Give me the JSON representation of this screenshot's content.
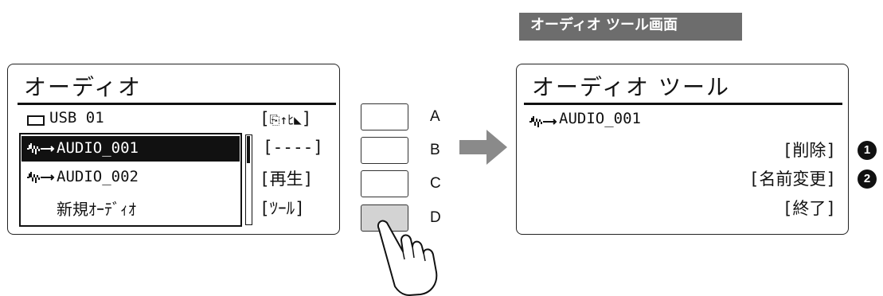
{
  "header": {
    "title": "オーディオ ツール画面"
  },
  "left_panel": {
    "title": "オーディオ",
    "device": "USB 01",
    "files": [
      {
        "name": "AUDIO_001",
        "selected": true
      },
      {
        "name": "AUDIO_002",
        "selected": false
      },
      {
        "name": "新規ｵｰﾃﾞｨｵ",
        "selected": false
      }
    ],
    "soft_keys": [
      "[",
      "----]",
      "[再生]",
      "[ﾂｰﾙ]"
    ]
  },
  "side_buttons": [
    {
      "label": "A",
      "pressed": false
    },
    {
      "label": "B",
      "pressed": false
    },
    {
      "label": "C",
      "pressed": false
    },
    {
      "label": "D",
      "pressed": true
    }
  ],
  "right_panel": {
    "title": "オーディオ ツール",
    "file": "AUDIO_001",
    "options": [
      {
        "label": "[削除]",
        "marker": "1"
      },
      {
        "label": "[名前変更]",
        "marker": "2"
      },
      {
        "label": "[終了]"
      }
    ]
  },
  "colors": {
    "badge": "#6d6d6d",
    "arrow": "#8a8a8a",
    "pressed_button": "#d3d3d3"
  }
}
